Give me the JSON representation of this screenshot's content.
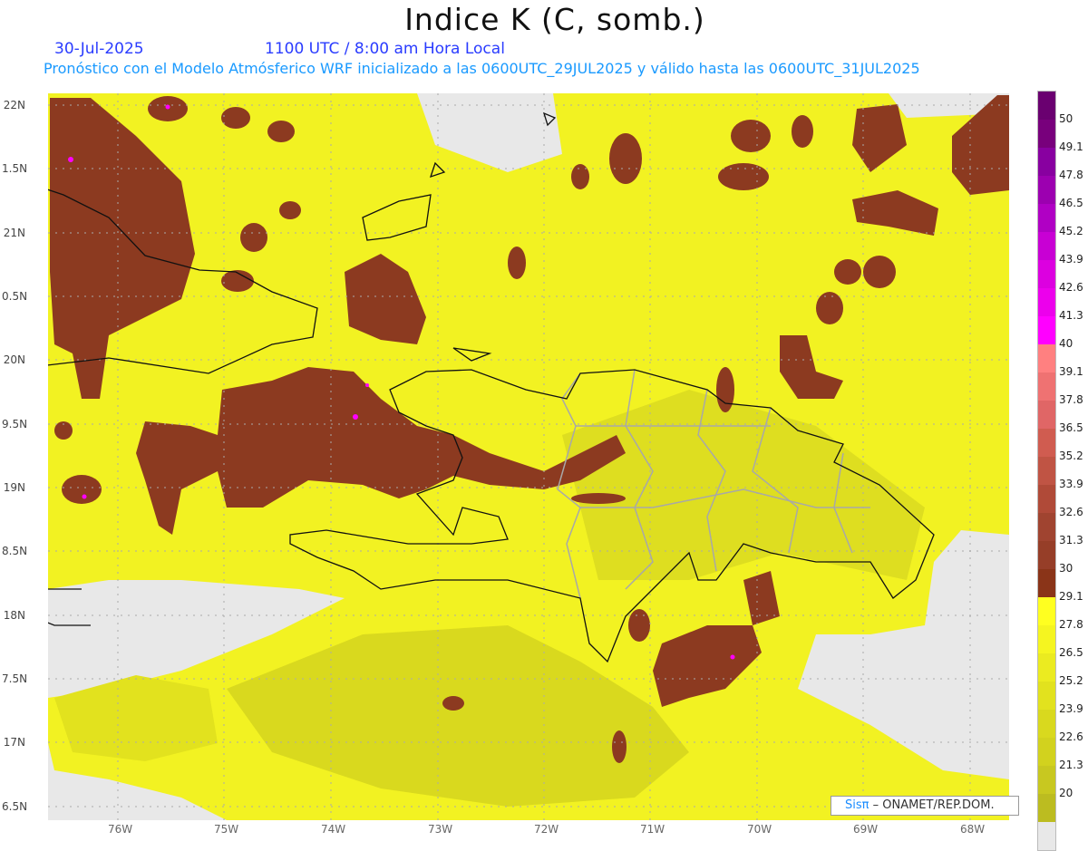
{
  "header": {
    "title": "Indice K (C, somb.)",
    "date": "30-Jul-2025",
    "time": "1100 UTC / 8:00 am Hora Local",
    "subtitle": "Pronóstico con el Modelo Atmósferico WRF inicializado a las 0600UTC_29JUL2025 y válido hasta las  0600UTC_31JUL2025"
  },
  "axes": {
    "lat_labels": [
      "22N",
      "1.5N",
      "21N",
      "0.5N",
      "20N",
      "9.5N",
      "19N",
      "8.5N",
      "18N",
      "7.5N",
      "17N",
      "6.5N"
    ],
    "lon_labels": [
      "76W",
      "75W",
      "74W",
      "73W",
      "72W",
      "71W",
      "70W",
      "69W",
      "68W"
    ]
  },
  "colorbar": {
    "labels": [
      "50",
      "49.1",
      "47.8",
      "46.5",
      "45.2",
      "43.9",
      "42.6",
      "41.3",
      "40",
      "39.1",
      "37.8",
      "36.5",
      "35.2",
      "33.9",
      "32.6",
      "31.3",
      "30",
      "29.1",
      "27.8",
      "26.5",
      "25.2",
      "23.9",
      "22.6",
      "21.3",
      "20"
    ],
    "colors": [
      "#6a0070",
      "#78007c",
      "#8800a0",
      "#9c00b0",
      "#b000c4",
      "#c800d4",
      "#dc00e0",
      "#ec00ec",
      "#ff00ff",
      "#ff8080",
      "#ef7272",
      "#e06666",
      "#d05c50",
      "#c05444",
      "#b04a38",
      "#a04430",
      "#963e28",
      "#8a3418",
      "#ffff20",
      "#f5f520",
      "#ebeb20",
      "#e2e21e",
      "#d9d91e",
      "#d2d21e",
      "#c8c820",
      "#bcbc20",
      "#e8e8e8"
    ]
  },
  "colors": {
    "yellow": "#f4f422",
    "brown": "#8c3a20",
    "gray": "#e8e8e8",
    "coast": "#111111",
    "border": "#a0a0a0"
  },
  "credit": {
    "logo": "Sisπ",
    "text": " – ONAMET/REP.DOM."
  }
}
